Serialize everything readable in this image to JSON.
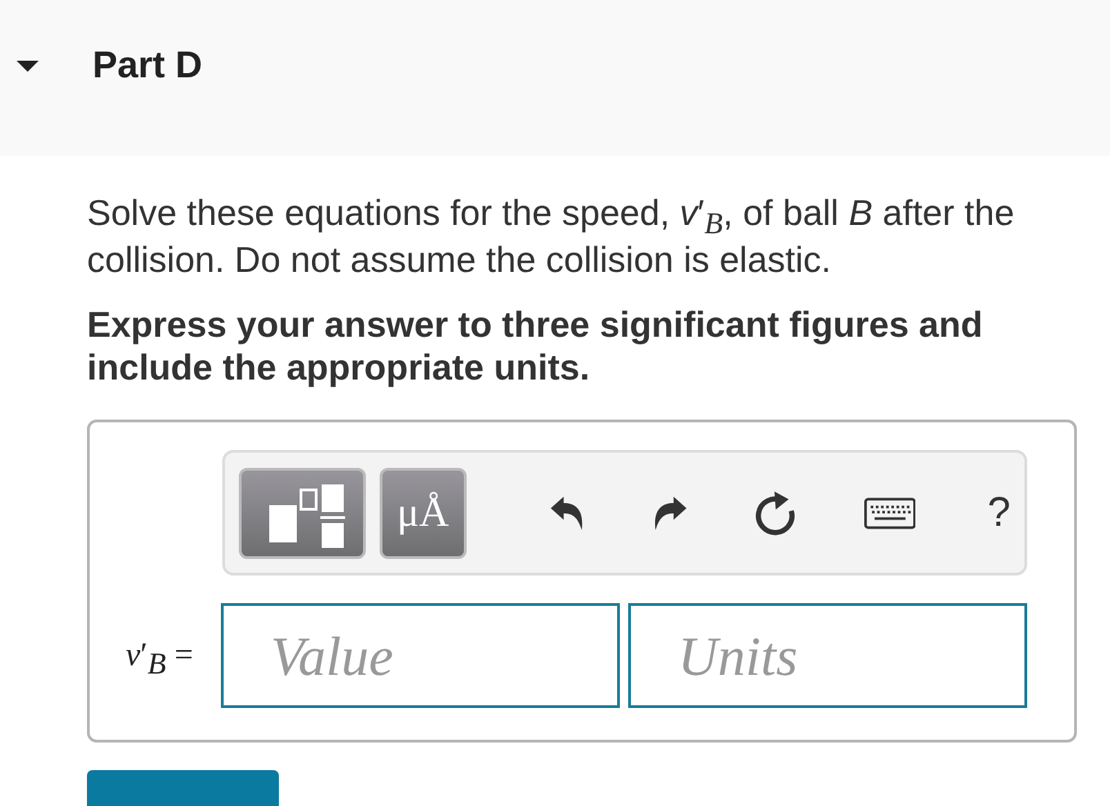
{
  "part": {
    "title": "Part D",
    "expanded": true
  },
  "prompt": "Solve these equations for the speed, *v*′$_{B}$, of ball *B* after the collision. Do not assume the collision is elastic.",
  "instruction": "Express your answer to three significant figures and include the appropriate units.",
  "toolbar": [
    {
      "kind": "template"
    },
    {
      "kind": "units",
      "label": "μÅ"
    },
    {
      "kind": "undo"
    },
    {
      "kind": "redo"
    },
    {
      "kind": "reset"
    },
    {
      "kind": "keyboard"
    },
    {
      "kind": "help",
      "label": "?"
    }
  ],
  "answer": {
    "label": "*v*′$_{B}$ =",
    "value_placeholder": "Value",
    "units_placeholder": "Units"
  }
}
